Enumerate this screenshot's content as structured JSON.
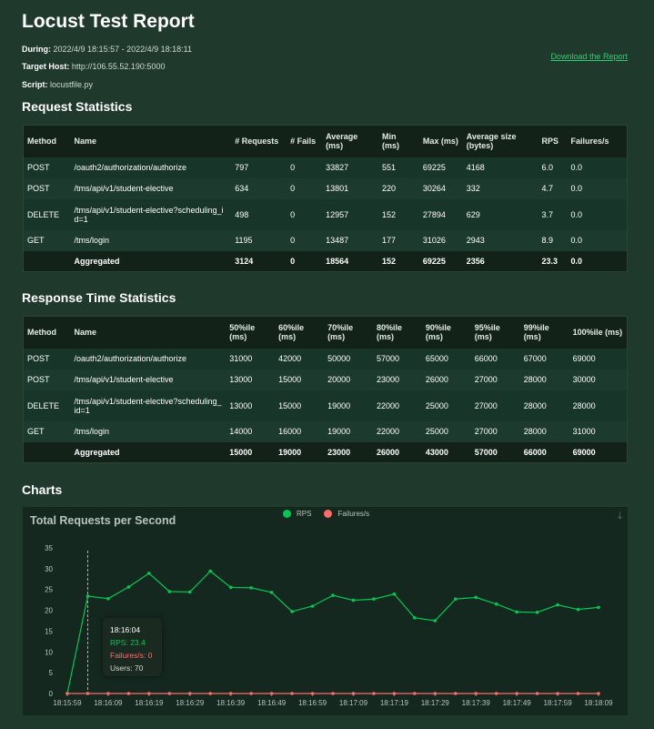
{
  "report": {
    "title": "Locust Test Report",
    "during_label": "During:",
    "during_value": "2022/4/9 18:15:57 - 2022/4/9 18:18:11",
    "host_label": "Target Host:",
    "host_value": "http://106.55.52.190:5000",
    "script_label": "Script:",
    "script_value": "locustfile.py",
    "download_link": "Download the Report"
  },
  "request_stats": {
    "title": "Request Statistics",
    "headers": [
      "Method",
      "Name",
      "# Requests",
      "# Fails",
      "Average (ms)",
      "Min (ms)",
      "Max (ms)",
      "Average size (bytes)",
      "RPS",
      "Failures/s"
    ],
    "rows": [
      [
        "POST",
        "/oauth2/authorization/authorize",
        "797",
        "0",
        "33827",
        "551",
        "69225",
        "4168",
        "6.0",
        "0.0"
      ],
      [
        "POST",
        "/tms/api/v1/student-elective",
        "634",
        "0",
        "13801",
        "220",
        "30264",
        "332",
        "4.7",
        "0.0"
      ],
      [
        "DELETE",
        "/tms/api/v1/student-elective?scheduling_id=1",
        "498",
        "0",
        "12957",
        "152",
        "27894",
        "629",
        "3.7",
        "0.0"
      ],
      [
        "GET",
        "/tms/login",
        "1195",
        "0",
        "13487",
        "177",
        "31026",
        "2943",
        "8.9",
        "0.0"
      ],
      [
        "",
        "Aggregated",
        "3124",
        "0",
        "18564",
        "152",
        "69225",
        "2356",
        "23.3",
        "0.0"
      ]
    ]
  },
  "response_stats": {
    "title": "Response Time Statistics",
    "headers": [
      "Method",
      "Name",
      "50%ile (ms)",
      "60%ile (ms)",
      "70%ile (ms)",
      "80%ile (ms)",
      "90%ile (ms)",
      "95%ile (ms)",
      "99%ile (ms)",
      "100%ile (ms)"
    ],
    "rows": [
      [
        "POST",
        "/oauth2/authorization/authorize",
        "31000",
        "42000",
        "50000",
        "57000",
        "65000",
        "66000",
        "67000",
        "69000"
      ],
      [
        "POST",
        "/tms/api/v1/student-elective",
        "13000",
        "15000",
        "20000",
        "23000",
        "26000",
        "27000",
        "28000",
        "30000"
      ],
      [
        "DELETE",
        "/tms/api/v1/student-elective?scheduling_id=1",
        "13000",
        "15000",
        "19000",
        "22000",
        "25000",
        "27000",
        "28000",
        "28000"
      ],
      [
        "GET",
        "/tms/login",
        "14000",
        "16000",
        "19000",
        "22000",
        "25000",
        "27000",
        "28000",
        "31000"
      ],
      [
        "",
        "Aggregated",
        "15000",
        "19000",
        "23000",
        "26000",
        "43000",
        "57000",
        "66000",
        "69000"
      ]
    ]
  },
  "charts_title": "Charts",
  "chart_data": {
    "type": "line",
    "title": "Total Requests per Second",
    "xlabel": "",
    "ylabel": "",
    "x_ticks": [
      "18:15:59",
      "18:16:09",
      "18:16:19",
      "18:16:29",
      "18:16:39",
      "18:16:49",
      "18:16:59",
      "18:17:09",
      "18:17:19",
      "18:17:29",
      "18:17:39",
      "18:17:49",
      "18:17:59",
      "18:18:09"
    ],
    "y_ticks": [
      "0",
      "5",
      "10",
      "15",
      "20",
      "25",
      "30",
      "35"
    ],
    "ylim": [
      0,
      35
    ],
    "legend_position": "top-center",
    "series": [
      {
        "name": "RPS",
        "color": "#00c853",
        "values": [
          0,
          23.4,
          22.8,
          25.6,
          28.9,
          24.5,
          24.4,
          29.4,
          25.5,
          25.4,
          24.3,
          19.7,
          21.0,
          23.6,
          22.4,
          22.7,
          23.9,
          18.2,
          17.5,
          22.7,
          23.1,
          21.5,
          19.6,
          19.5,
          21.3,
          20.2,
          20.7
        ]
      },
      {
        "name": "Failures/s",
        "color": "#ff6b6b",
        "values": [
          0,
          0,
          0,
          0,
          0,
          0,
          0,
          0,
          0,
          0,
          0,
          0,
          0,
          0,
          0,
          0,
          0,
          0,
          0,
          0,
          0,
          0,
          0,
          0,
          0,
          0,
          0
        ]
      }
    ],
    "tooltip": {
      "time": "18:16:04",
      "rps": "RPS: 23.4",
      "failures": "Failures/s: 0",
      "users": "Users: 70"
    }
  }
}
